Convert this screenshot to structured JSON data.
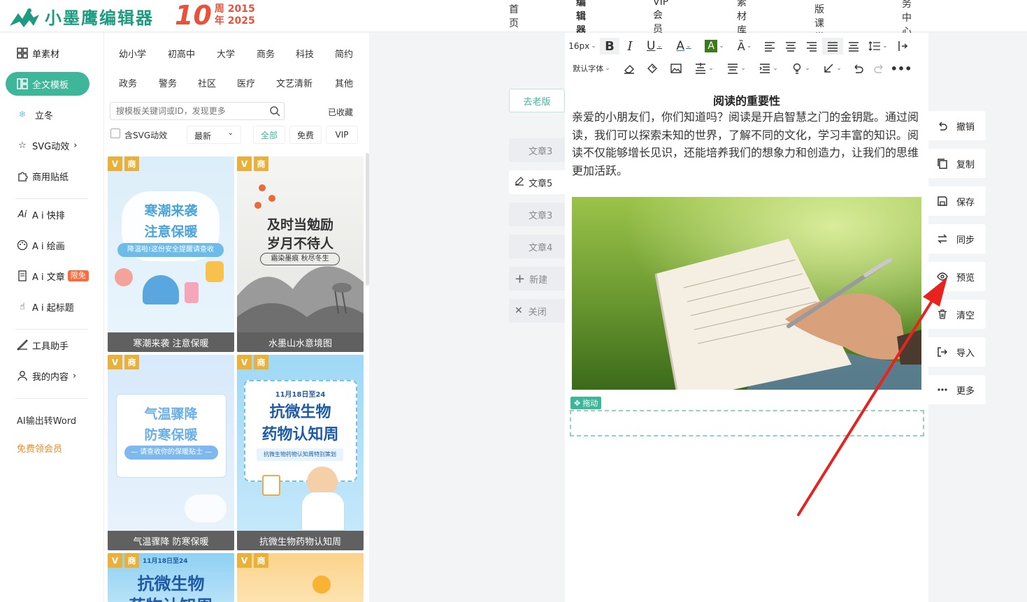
{
  "brand": {
    "name": "小墨鹰编辑器",
    "anniv_num": "10",
    "anniv_top": "周 2015",
    "anniv_bottom": "年 2025"
  },
  "nav": [
    "首页",
    "编辑器",
    "VIP会员",
    "素材库",
    "排版课堂",
    "服务中心"
  ],
  "sidebar": {
    "items": [
      "单素材",
      "全文模板",
      "立冬",
      "SVG动效",
      "商用贴纸",
      "A i 快排",
      "A i 绘画",
      "A i 文章",
      "A i 起标题",
      "工具助手",
      "我的内容"
    ],
    "limited_badge": "限免",
    "word_export": "AI输出转Word",
    "free_vip": "免费领会员"
  },
  "categories": [
    "幼小学",
    "初高中",
    "大学",
    "商务",
    "科技",
    "简约",
    "政务",
    "警务",
    "社区",
    "医疗",
    "文艺清新",
    "其他"
  ],
  "search": {
    "placeholder": "搜模板关键词或ID，发现更多",
    "collected": "已收藏"
  },
  "filters": {
    "svg_label": "含SVG动效",
    "sort": "最新",
    "options": [
      "全部",
      "免费",
      "VIP"
    ]
  },
  "tags": {
    "v": "V",
    "s": "商"
  },
  "cards": [
    {
      "title1": "寒潮来袭",
      "title2": "注意保暖",
      "sub": "降温啦!这份安全提醒请查收",
      "caption": "寒潮来袭 注意保暖"
    },
    {
      "title1": "及时当勉励",
      "title2": "岁月不待人",
      "sub": "霜染墨痕 秋尽冬生",
      "caption": "水墨山水意境图"
    },
    {
      "title1": "气温骤降",
      "title2": "防寒保暖",
      "sub": "— 请查收你的保暖贴士 —",
      "caption": "气温骤降 防寒保暖"
    },
    {
      "title0": "11月18日至24",
      "title1": "抗微生物",
      "title2": "药物认知周",
      "sub": "抗微生物药物认知周特别策划",
      "caption": "抗微生物药物认知周"
    },
    {
      "title0": "11月18日至24",
      "title1": "抗微生物",
      "title2": "药物认知周"
    },
    {
      "title1": ""
    }
  ],
  "middle": {
    "go_old": "去老版",
    "tabs": [
      "文章3",
      "文章5",
      "文章3",
      "文章4",
      "新建",
      "关闭"
    ]
  },
  "toolbar": {
    "font_size": "16px",
    "font_family": "默认字体"
  },
  "doc": {
    "title": "阅读的重要性",
    "body": "亲爱的小朋友们，你们知道吗？阅读是开启智慧之门的金钥匙。通过阅读，我们可以探索未知的世界，了解不同的文化，学习丰富的知识。阅读不仅能够增长见识，还能培养我们的想象力和创造力，让我们的思维更加活跃。",
    "drag": "拖动"
  },
  "actions": [
    "撤销",
    "复制",
    "保存",
    "同步",
    "预览",
    "清空",
    "导入",
    "更多"
  ],
  "colors": {
    "accent": "#3eb699",
    "anniv": "#e8523c",
    "arrow": "#e8231f"
  }
}
